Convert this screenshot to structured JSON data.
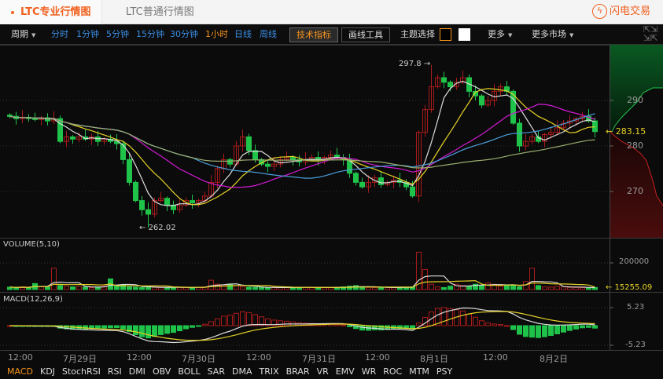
{
  "tabs": {
    "active": "LTC专业行情图",
    "other": "LTC普通行情图",
    "flash_trade": "闪电交易",
    "flash_icon": "lightning-icon"
  },
  "toolbar": {
    "period_label": "周期",
    "periods": [
      "分时",
      "1分钟",
      "5分钟",
      "15分钟",
      "30分钟",
      "1小时",
      "日线",
      "周线"
    ],
    "active_period": "1小时",
    "tech_indicators": "技术指标",
    "drawing_tools": "画线工具",
    "theme_label": "主题选择",
    "more": "更多",
    "more_markets": "更多市场",
    "fullscreen_icon": "expand-icon"
  },
  "price_axis": {
    "ticks": [
      "290",
      "280",
      "270"
    ],
    "current": "283.15",
    "high_label": "297.8",
    "low_label": "262.02"
  },
  "volume": {
    "title": "VOLUME(5,10)",
    "tick": "200000",
    "current": "15255.09"
  },
  "macd": {
    "title": "MACD(12,26,9)",
    "top": "5.23",
    "bottom": "-5.23"
  },
  "time_axis": [
    "12:00",
    "7月29日",
    "12:00",
    "7月30日",
    "12:00",
    "7月31日",
    "12:00",
    "8月1日",
    "12:00",
    "8月2日"
  ],
  "indicators": [
    "MACD",
    "KDJ",
    "StochRSI",
    "RSI",
    "DMI",
    "OBV",
    "BOLL",
    "SAR",
    "DMA",
    "TRIX",
    "BRAR",
    "VR",
    "EMV",
    "WR",
    "ROC",
    "MTM",
    "PSY"
  ],
  "active_indicator": "MACD",
  "colors": {
    "up": "#a81b1b",
    "down": "#1fc34a",
    "ma5": "#dddddd",
    "ma10": "#e6d226",
    "ma20": "#d41ad4",
    "ma30": "#4a9fdc",
    "ma60": "#9aae70",
    "accent": "#f7931e"
  },
  "chart_data": {
    "type": "candlestick",
    "open_first": 286.8,
    "closes": [
      286.5,
      286,
      286.3,
      286,
      285.8,
      286.2,
      285.5,
      286,
      281,
      282,
      281.5,
      282,
      281.5,
      282,
      281,
      281.5,
      281,
      280.5,
      277,
      272,
      268,
      266,
      265,
      268,
      268.5,
      267,
      266,
      267,
      268,
      267.5,
      268,
      269,
      272,
      275,
      277,
      276,
      280,
      282,
      279,
      277,
      276,
      275.5,
      276,
      277,
      277.5,
      277,
      276.5,
      277,
      277.5,
      277,
      277.5,
      278,
      277.5,
      277,
      274,
      272,
      271,
      272,
      273,
      271.5,
      272,
      272.5,
      272,
      271,
      269,
      283,
      288,
      293,
      295,
      294,
      293,
      294,
      295,
      292,
      291,
      289,
      290,
      292,
      293,
      292,
      285,
      280,
      281,
      282,
      281,
      282.5,
      283,
      284,
      285,
      285.5,
      286,
      286.5,
      285.5,
      283.15
    ],
    "high": 297.8,
    "high_index": 67,
    "low": 262.02,
    "low_index": 22,
    "volumes": [
      18000,
      15000,
      20000,
      16000,
      45000,
      22000,
      18000,
      160000,
      30000,
      25000,
      20000,
      22000,
      18000,
      15000,
      20000,
      25000,
      80000,
      30000,
      35000,
      20000,
      18000,
      15000,
      17000,
      20000,
      16000,
      14000,
      15000,
      16000,
      18000,
      15000,
      17000,
      20000,
      70000,
      40000,
      35000,
      40000,
      30000,
      20000,
      18000,
      16000,
      15000,
      14000,
      16000,
      15000,
      17000,
      15000,
      16000,
      18000,
      15000,
      14000,
      16000,
      15000,
      17000,
      20000,
      25000,
      30000,
      18000,
      16000,
      15000,
      14000,
      16000,
      15000,
      17000,
      18000,
      20000,
      280000,
      150000,
      40000,
      20000,
      15000,
      25000,
      40000,
      30000,
      25000,
      40000,
      30000,
      50000,
      40000,
      25000,
      30000,
      35000,
      20000,
      60000,
      160000,
      30000,
      20000,
      18000,
      25000,
      20000,
      16000,
      15000,
      14000,
      15000,
      15255.09
    ],
    "price_ticks": [
      290,
      280,
      270
    ],
    "ma_periods": [
      5,
      10,
      20,
      30,
      60
    ]
  }
}
